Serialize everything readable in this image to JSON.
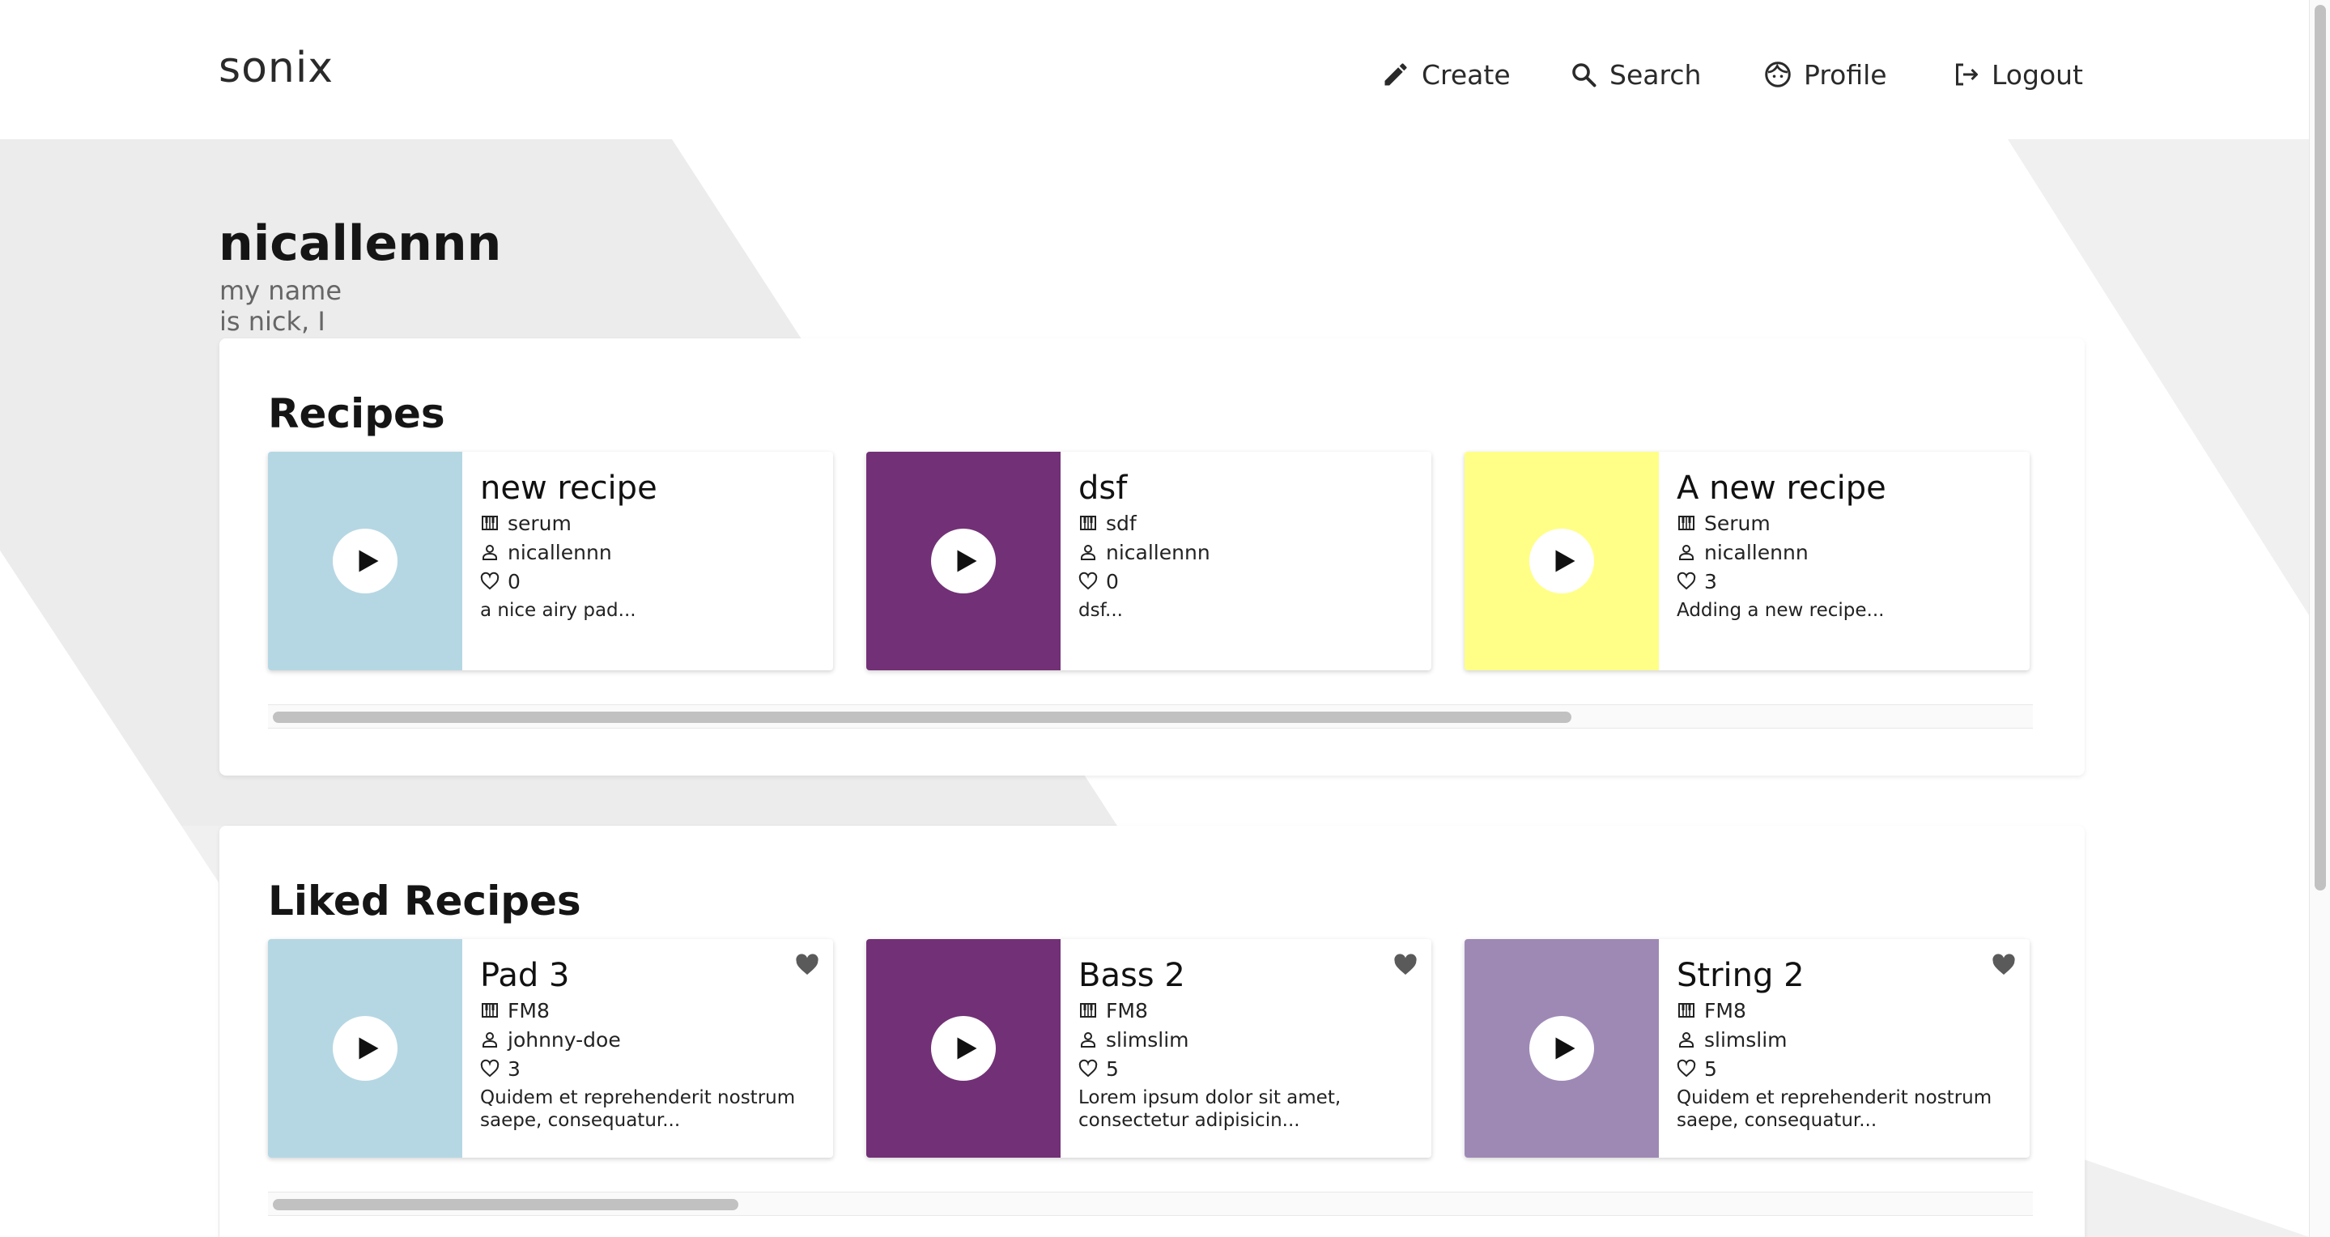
{
  "app": {
    "brand": "sonix"
  },
  "nav": {
    "create": "Create",
    "search": "Search",
    "profile": "Profile",
    "logout": "Logout"
  },
  "profile": {
    "username": "nicallennn",
    "bio": "my name is nick, I am the creator of this application"
  },
  "recipes": {
    "title": "Recipes",
    "items": [
      {
        "title": "new recipe",
        "synth": "serum",
        "author": "nicallennn",
        "likes": "0",
        "desc": "a nice airy pad...",
        "color": "#b5d7e3"
      },
      {
        "title": "dsf",
        "synth": "sdf",
        "author": "nicallennn",
        "likes": "0",
        "desc": "dsf...",
        "color": "#723076"
      },
      {
        "title": "A new recipe",
        "synth": "Serum",
        "author": "nicallennn",
        "likes": "3",
        "desc": "Adding a new recipe...",
        "color": "#ffff88"
      }
    ],
    "scroll_fraction": 0.74
  },
  "liked": {
    "title": "Liked Recipes",
    "items": [
      {
        "title": "Pad 3",
        "synth": "FM8",
        "author": "johnny-doe",
        "likes": "3",
        "desc": "Quidem et reprehenderit nostrum saepe, consequatur...",
        "color": "#b5d7e3"
      },
      {
        "title": "Bass 2",
        "synth": "FM8",
        "author": "slimslim",
        "likes": "5",
        "desc": "Lorem ipsum dolor sit amet, consectetur adipisicin...",
        "color": "#723076"
      },
      {
        "title": "String 2",
        "synth": "FM8",
        "author": "slimslim",
        "likes": "5",
        "desc": "Quidem et reprehenderit nostrum saepe, consequatur...",
        "color": "#9e89b5"
      }
    ],
    "scroll_fraction": 0.265
  },
  "icons": {
    "nav": [
      "pencil-icon",
      "search-icon",
      "face-icon",
      "logout-icon"
    ],
    "card": [
      "play-icon",
      "piano-icon",
      "user-icon",
      "heart-outline-icon",
      "heart-filled-icon"
    ]
  }
}
